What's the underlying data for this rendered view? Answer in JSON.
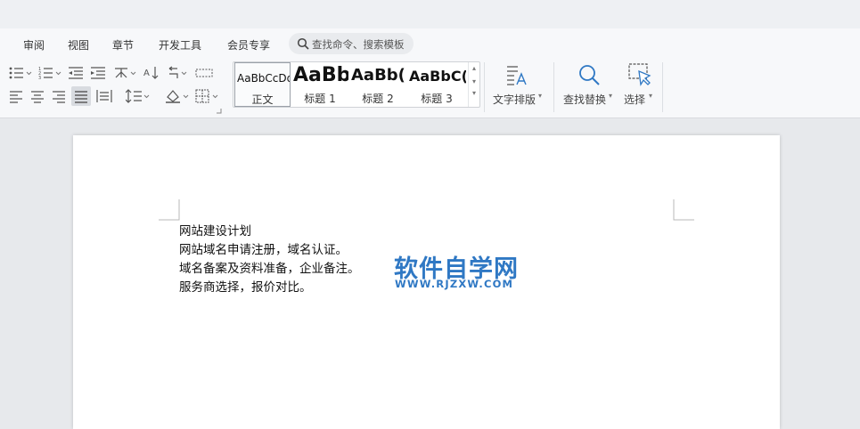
{
  "ribbon": {
    "tabs": [
      {
        "label": "审阅"
      },
      {
        "label": "视图"
      },
      {
        "label": "章节"
      },
      {
        "label": "开发工具"
      },
      {
        "label": "会员专享"
      }
    ],
    "search": {
      "placeholder": "查找命令、搜索模板"
    },
    "styles": [
      {
        "preview": "AaBbCcDd",
        "label": "正文"
      },
      {
        "preview": "AaBb",
        "label": "标题 1"
      },
      {
        "preview": "AaBb(",
        "label": "标题 2"
      },
      {
        "preview": "AaBbC(",
        "label": "标题 3"
      }
    ],
    "text_layout_label": "文字排版",
    "find_replace_label": "查找替换",
    "select_label": "选择"
  },
  "document": {
    "lines": [
      "网站建设计划",
      "网站域名申请注册，域名认证。",
      "域名备案及资料准备，企业备注。",
      "服务商选择，报价对比。"
    ],
    "watermark": {
      "title": "软件自学网",
      "url": "WWW.RJZXW.COM"
    }
  },
  "colors": {
    "accent": "#2f78c4",
    "ribbon_bg": "#f7f8fa",
    "workspace_bg": "#e7e9ec"
  }
}
